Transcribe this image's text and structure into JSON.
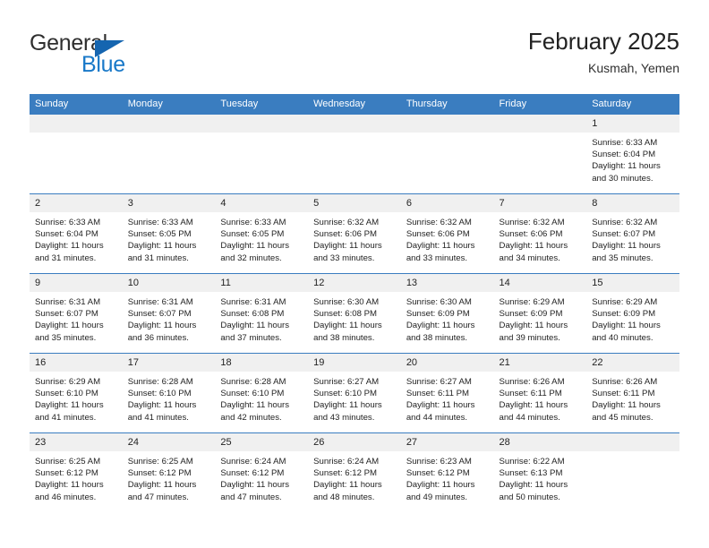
{
  "logo": {
    "word_one": "General",
    "word_two": "Blue",
    "accent_color": "#1565b0",
    "blue_text_color": "#1878c8"
  },
  "header": {
    "title": "February 2025",
    "location": "Kusmah, Yemen"
  },
  "calendar": {
    "header_color": "#3a7dc0",
    "daynum_band_color": "#f0f0f0",
    "weekday_headers": [
      "Sunday",
      "Monday",
      "Tuesday",
      "Wednesday",
      "Thursday",
      "Friday",
      "Saturday"
    ],
    "weeks": [
      [
        {
          "day": "",
          "sunrise": "",
          "sunset": "",
          "daylight_a": "",
          "daylight_b": ""
        },
        {
          "day": "",
          "sunrise": "",
          "sunset": "",
          "daylight_a": "",
          "daylight_b": ""
        },
        {
          "day": "",
          "sunrise": "",
          "sunset": "",
          "daylight_a": "",
          "daylight_b": ""
        },
        {
          "day": "",
          "sunrise": "",
          "sunset": "",
          "daylight_a": "",
          "daylight_b": ""
        },
        {
          "day": "",
          "sunrise": "",
          "sunset": "",
          "daylight_a": "",
          "daylight_b": ""
        },
        {
          "day": "",
          "sunrise": "",
          "sunset": "",
          "daylight_a": "",
          "daylight_b": ""
        },
        {
          "day": "1",
          "sunrise": "Sunrise: 6:33 AM",
          "sunset": "Sunset: 6:04 PM",
          "daylight_a": "Daylight: 11 hours",
          "daylight_b": "and 30 minutes."
        }
      ],
      [
        {
          "day": "2",
          "sunrise": "Sunrise: 6:33 AM",
          "sunset": "Sunset: 6:04 PM",
          "daylight_a": "Daylight: 11 hours",
          "daylight_b": "and 31 minutes."
        },
        {
          "day": "3",
          "sunrise": "Sunrise: 6:33 AM",
          "sunset": "Sunset: 6:05 PM",
          "daylight_a": "Daylight: 11 hours",
          "daylight_b": "and 31 minutes."
        },
        {
          "day": "4",
          "sunrise": "Sunrise: 6:33 AM",
          "sunset": "Sunset: 6:05 PM",
          "daylight_a": "Daylight: 11 hours",
          "daylight_b": "and 32 minutes."
        },
        {
          "day": "5",
          "sunrise": "Sunrise: 6:32 AM",
          "sunset": "Sunset: 6:06 PM",
          "daylight_a": "Daylight: 11 hours",
          "daylight_b": "and 33 minutes."
        },
        {
          "day": "6",
          "sunrise": "Sunrise: 6:32 AM",
          "sunset": "Sunset: 6:06 PM",
          "daylight_a": "Daylight: 11 hours",
          "daylight_b": "and 33 minutes."
        },
        {
          "day": "7",
          "sunrise": "Sunrise: 6:32 AM",
          "sunset": "Sunset: 6:06 PM",
          "daylight_a": "Daylight: 11 hours",
          "daylight_b": "and 34 minutes."
        },
        {
          "day": "8",
          "sunrise": "Sunrise: 6:32 AM",
          "sunset": "Sunset: 6:07 PM",
          "daylight_a": "Daylight: 11 hours",
          "daylight_b": "and 35 minutes."
        }
      ],
      [
        {
          "day": "9",
          "sunrise": "Sunrise: 6:31 AM",
          "sunset": "Sunset: 6:07 PM",
          "daylight_a": "Daylight: 11 hours",
          "daylight_b": "and 35 minutes."
        },
        {
          "day": "10",
          "sunrise": "Sunrise: 6:31 AM",
          "sunset": "Sunset: 6:07 PM",
          "daylight_a": "Daylight: 11 hours",
          "daylight_b": "and 36 minutes."
        },
        {
          "day": "11",
          "sunrise": "Sunrise: 6:31 AM",
          "sunset": "Sunset: 6:08 PM",
          "daylight_a": "Daylight: 11 hours",
          "daylight_b": "and 37 minutes."
        },
        {
          "day": "12",
          "sunrise": "Sunrise: 6:30 AM",
          "sunset": "Sunset: 6:08 PM",
          "daylight_a": "Daylight: 11 hours",
          "daylight_b": "and 38 minutes."
        },
        {
          "day": "13",
          "sunrise": "Sunrise: 6:30 AM",
          "sunset": "Sunset: 6:09 PM",
          "daylight_a": "Daylight: 11 hours",
          "daylight_b": "and 38 minutes."
        },
        {
          "day": "14",
          "sunrise": "Sunrise: 6:29 AM",
          "sunset": "Sunset: 6:09 PM",
          "daylight_a": "Daylight: 11 hours",
          "daylight_b": "and 39 minutes."
        },
        {
          "day": "15",
          "sunrise": "Sunrise: 6:29 AM",
          "sunset": "Sunset: 6:09 PM",
          "daylight_a": "Daylight: 11 hours",
          "daylight_b": "and 40 minutes."
        }
      ],
      [
        {
          "day": "16",
          "sunrise": "Sunrise: 6:29 AM",
          "sunset": "Sunset: 6:10 PM",
          "daylight_a": "Daylight: 11 hours",
          "daylight_b": "and 41 minutes."
        },
        {
          "day": "17",
          "sunrise": "Sunrise: 6:28 AM",
          "sunset": "Sunset: 6:10 PM",
          "daylight_a": "Daylight: 11 hours",
          "daylight_b": "and 41 minutes."
        },
        {
          "day": "18",
          "sunrise": "Sunrise: 6:28 AM",
          "sunset": "Sunset: 6:10 PM",
          "daylight_a": "Daylight: 11 hours",
          "daylight_b": "and 42 minutes."
        },
        {
          "day": "19",
          "sunrise": "Sunrise: 6:27 AM",
          "sunset": "Sunset: 6:10 PM",
          "daylight_a": "Daylight: 11 hours",
          "daylight_b": "and 43 minutes."
        },
        {
          "day": "20",
          "sunrise": "Sunrise: 6:27 AM",
          "sunset": "Sunset: 6:11 PM",
          "daylight_a": "Daylight: 11 hours",
          "daylight_b": "and 44 minutes."
        },
        {
          "day": "21",
          "sunrise": "Sunrise: 6:26 AM",
          "sunset": "Sunset: 6:11 PM",
          "daylight_a": "Daylight: 11 hours",
          "daylight_b": "and 44 minutes."
        },
        {
          "day": "22",
          "sunrise": "Sunrise: 6:26 AM",
          "sunset": "Sunset: 6:11 PM",
          "daylight_a": "Daylight: 11 hours",
          "daylight_b": "and 45 minutes."
        }
      ],
      [
        {
          "day": "23",
          "sunrise": "Sunrise: 6:25 AM",
          "sunset": "Sunset: 6:12 PM",
          "daylight_a": "Daylight: 11 hours",
          "daylight_b": "and 46 minutes."
        },
        {
          "day": "24",
          "sunrise": "Sunrise: 6:25 AM",
          "sunset": "Sunset: 6:12 PM",
          "daylight_a": "Daylight: 11 hours",
          "daylight_b": "and 47 minutes."
        },
        {
          "day": "25",
          "sunrise": "Sunrise: 6:24 AM",
          "sunset": "Sunset: 6:12 PM",
          "daylight_a": "Daylight: 11 hours",
          "daylight_b": "and 47 minutes."
        },
        {
          "day": "26",
          "sunrise": "Sunrise: 6:24 AM",
          "sunset": "Sunset: 6:12 PM",
          "daylight_a": "Daylight: 11 hours",
          "daylight_b": "and 48 minutes."
        },
        {
          "day": "27",
          "sunrise": "Sunrise: 6:23 AM",
          "sunset": "Sunset: 6:12 PM",
          "daylight_a": "Daylight: 11 hours",
          "daylight_b": "and 49 minutes."
        },
        {
          "day": "28",
          "sunrise": "Sunrise: 6:22 AM",
          "sunset": "Sunset: 6:13 PM",
          "daylight_a": "Daylight: 11 hours",
          "daylight_b": "and 50 minutes."
        },
        {
          "day": "",
          "sunrise": "",
          "sunset": "",
          "daylight_a": "",
          "daylight_b": ""
        }
      ]
    ]
  }
}
